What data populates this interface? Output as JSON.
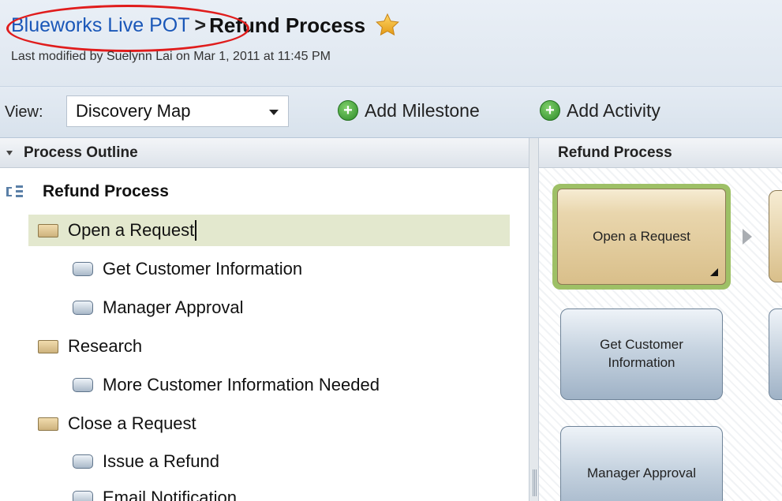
{
  "breadcrumb": {
    "space_link": "Blueworks Live POT",
    "separator": ">",
    "title": "Refund Process"
  },
  "last_modified": "Last modified by Suelynn Lai on Mar 1, 2011 at 11:45 PM",
  "toolbar": {
    "view_label": "View:",
    "view_selected": "Discovery Map",
    "add_milestone": "Add Milestone",
    "add_activity": "Add Activity"
  },
  "outline": {
    "header": "Process Outline",
    "root": "Refund Process",
    "items": [
      {
        "label": "Open a Request",
        "kind": "milestone",
        "selected": true
      },
      {
        "label": "Get Customer Information",
        "kind": "activity"
      },
      {
        "label": "Manager Approval",
        "kind": "activity"
      },
      {
        "label": "Research",
        "kind": "milestone"
      },
      {
        "label": "More Customer Information Needed",
        "kind": "activity"
      },
      {
        "label": "Close a Request",
        "kind": "milestone"
      },
      {
        "label": "Issue a Refund",
        "kind": "activity"
      },
      {
        "label": "Email Notification",
        "kind": "activity"
      }
    ]
  },
  "map": {
    "header": "Refund Process",
    "milestone_card": "Open a Request",
    "activity_cards": [
      "Get Customer Information",
      "Manager Approval"
    ]
  },
  "colors": {
    "link": "#1a57b8",
    "annotation_oval": "#e01c1c",
    "selection": "#e3e8ce",
    "milestone_highlight": "#9ec066"
  }
}
